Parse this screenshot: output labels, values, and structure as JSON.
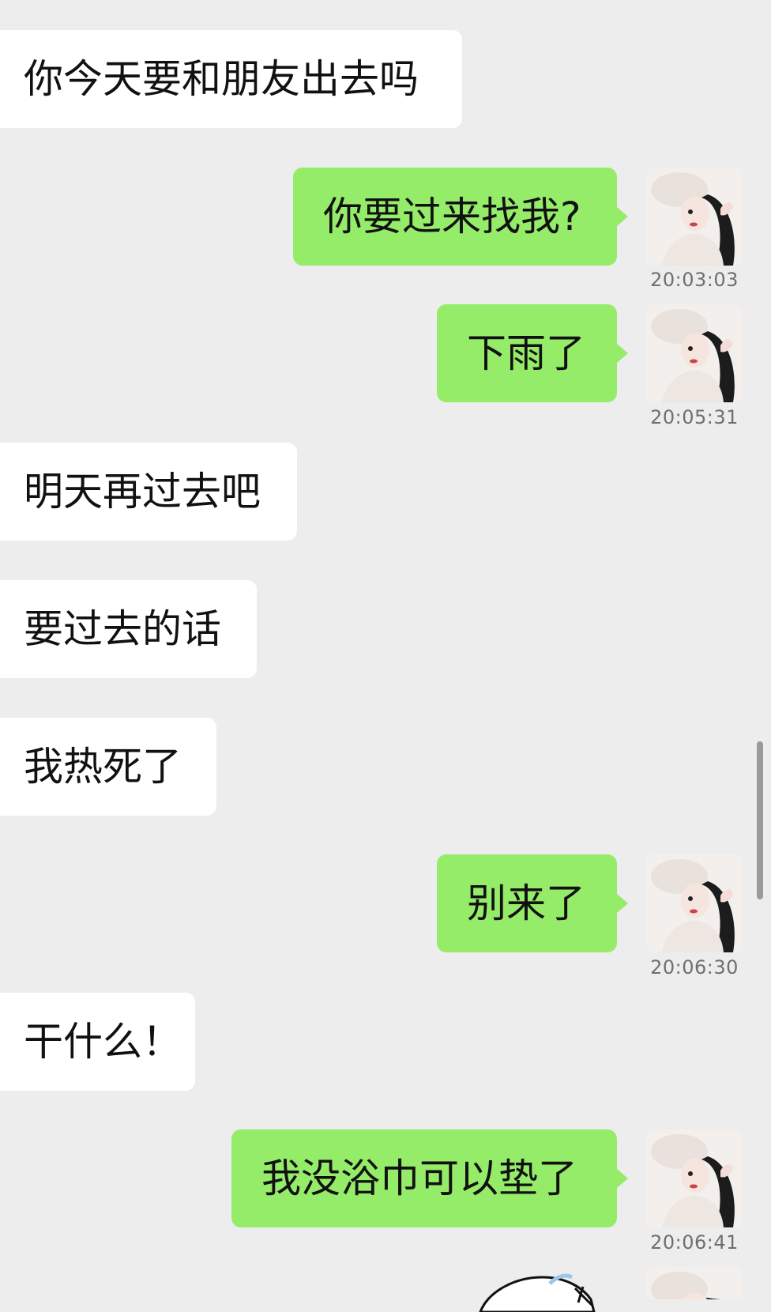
{
  "messages": [
    {
      "side": "in",
      "text": "你今天要和朋友出去吗"
    },
    {
      "side": "out",
      "text": "你要过来找我?",
      "time": "20:03:03"
    },
    {
      "side": "out",
      "text": "下雨了",
      "time": "20:05:31"
    },
    {
      "side": "in",
      "text": "明天再过去吧"
    },
    {
      "side": "in",
      "text": "要过去的话"
    },
    {
      "side": "in",
      "text": "我热死了"
    },
    {
      "side": "out",
      "text": "别来了",
      "time": "20:06:30"
    },
    {
      "side": "in",
      "text": "干什么！"
    },
    {
      "side": "out",
      "text": "我没浴巾可以垫了",
      "time": "20:06:41"
    }
  ],
  "colors": {
    "background": "#ededed",
    "incoming_bubble": "#ffffff",
    "outgoing_bubble": "#95ec69",
    "timestamp": "#6f6f6f"
  },
  "icons": {
    "avatar": "user-avatar",
    "sticker": "partial-sticker"
  }
}
